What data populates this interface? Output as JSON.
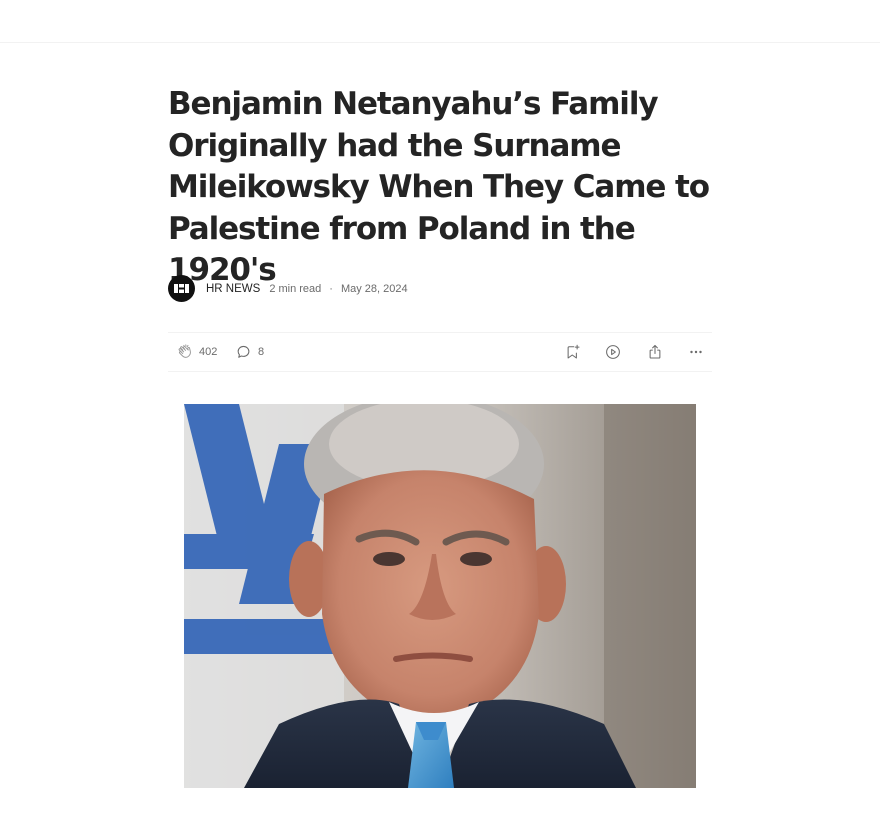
{
  "article": {
    "title": "Benjamin Netanyahu’s Family Originally had the Surname Mileikowsky When They Came to Palestine from Poland in the 1920's",
    "publication": "HR NEWS",
    "read_time": "2 min read",
    "separator": "·",
    "date": "May 28, 2024"
  },
  "actions": {
    "claps": "402",
    "responses": "8"
  },
  "icons": {
    "clap": "clap-icon",
    "response": "response-bubble-icon",
    "save": "bookmark-add-icon",
    "listen": "play-circle-icon",
    "share": "share-icon",
    "more": "more-horizontal-icon"
  },
  "colors": {
    "text": "#242424",
    "muted": "#6b6b6b",
    "divider": "#f2f2f2"
  }
}
